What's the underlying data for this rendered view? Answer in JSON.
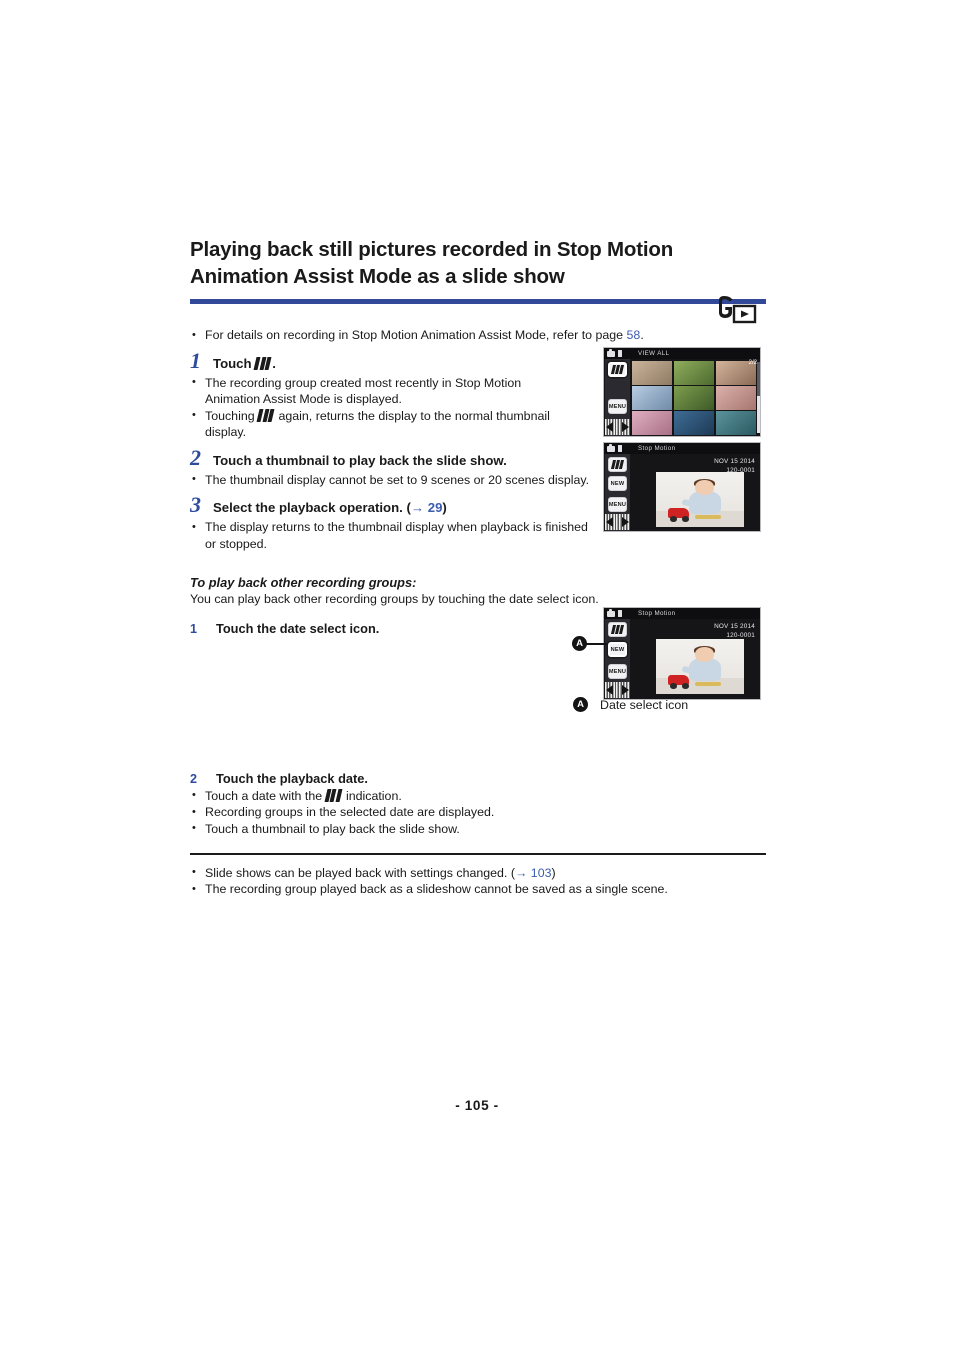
{
  "document": {
    "title_line1": "Playing back still pictures recorded in Stop Motion",
    "title_line2": "Animation Assist Mode as a slide show",
    "page_number": "- 105 -",
    "accent_color": "#32499a",
    "link_color": "#3b5cb0"
  },
  "mode_icon": {
    "name": "photo-playback-mode-icon"
  },
  "intro": {
    "bullet": "For details on recording in Stop Motion Animation Assist Mode, refer to page ",
    "link": "58",
    "bullet_end": "."
  },
  "steps": [
    {
      "number": "1",
      "text_before_icon": "Touch ",
      "icon": "stop-motion-icon",
      "text_after_icon": ".",
      "bullets": [
        "The recording group created most recently in Stop Motion Animation Assist Mode is displayed.",
        {
          "before": "Touching ",
          "icon": "stop-motion-icon",
          "after": " again, returns the display to the normal thumbnail display."
        }
      ]
    },
    {
      "number": "2",
      "text": "Touch a thumbnail to play back the slide show.",
      "bullets": [
        "The thumbnail display cannot be set to 9 scenes or 20 scenes display."
      ]
    },
    {
      "number": "3",
      "text_before_ref": "Select the playback operation. (",
      "ref_arrow": "→",
      "ref_page": "29",
      "text_after_ref": ")",
      "bullets": [
        "The display returns to the thumbnail display when playback is finished or stopped."
      ]
    }
  ],
  "section": {
    "heading": "To play back other recording groups:",
    "paragraph": "You can play back other recording groups by touching the date select icon.",
    "substeps": [
      {
        "number": "1",
        "text": "Touch the date select icon."
      },
      {
        "number": "2",
        "text": "Touch the playback date."
      }
    ],
    "substep2_bullets": [
      {
        "before": "Touch a date with the ",
        "icon": "stop-motion-icon",
        "after": " indication."
      },
      "Recording groups in the selected date are displayed.",
      "Touch a thumbnail to play back the slide show."
    ],
    "callout": {
      "marker": "A",
      "label": "Date select icon"
    }
  },
  "notes": [
    {
      "before": "Slide shows can be played back with settings changed. (",
      "arrow": "→",
      "ref_page": "103",
      "after": ")"
    },
    "The recording group played back as a slideshow cannot be saved as a single scene."
  ],
  "screens": {
    "thumbnail_view": {
      "name": "viewfinder-thumbnail-grid-screen",
      "title": "VIEW ALL",
      "page_count": "2/2",
      "menu_button": "MENU",
      "stop_motion_button": "stop-motion-icon",
      "thumbnail_colors": [
        "#b79a86",
        "#6f8f4c",
        "#a98f7a",
        "#9ab4d0",
        "#5d7f3e",
        "#c49d9a",
        "#d0a4b8",
        "#3c6b93",
        "#4a7f86"
      ]
    },
    "single_view": {
      "name": "viewfinder-single-photo-screen",
      "title": "Stop Motion",
      "date": "NOV 15 2014",
      "file_number": "120-0001",
      "menu_button": "MENU",
      "new_button": "NEW",
      "stop_motion_button": "stop-motion-icon"
    },
    "date_select_view": {
      "name": "viewfinder-date-select-screen",
      "title": "Stop Motion",
      "date": "NOV 15 2014",
      "file_number": "120-0001",
      "menu_button": "MENU",
      "new_button": "NEW",
      "stop_motion_button": "stop-motion-icon"
    }
  }
}
